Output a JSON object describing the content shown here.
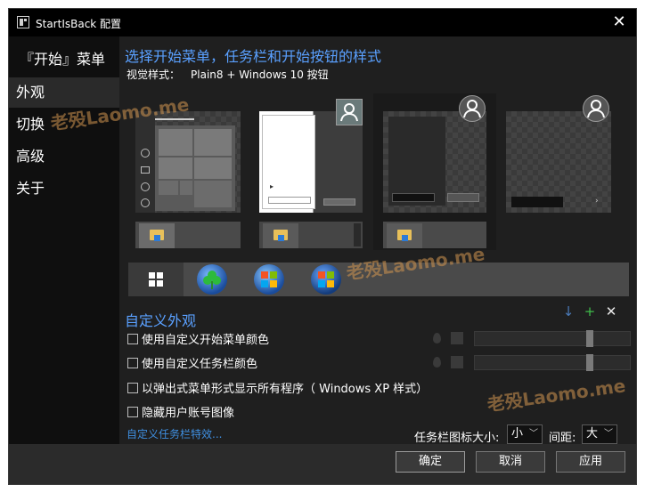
{
  "window": {
    "title": "StartIsBack 配置",
    "close_glyph": "✕"
  },
  "sidebar": {
    "header": "『开始』菜单",
    "items": [
      {
        "label": "外观",
        "active": true
      },
      {
        "label": "切换",
        "active": false
      },
      {
        "label": "高级",
        "active": false
      },
      {
        "label": "关于",
        "active": false
      }
    ]
  },
  "main": {
    "heading": "选择开始菜单，任务栏和开始按钮的样式",
    "visual_style_label": "视觉样式：",
    "visual_style_value": "Plain8 + Windows 10 按钮",
    "custom_heading": "自定义外观",
    "toolbar_icons": [
      "download-arrow-icon",
      "plus-icon",
      "close-icon"
    ],
    "options": [
      {
        "label": "使用自定义开始菜单颜色",
        "checked": false
      },
      {
        "label": "使用自定义任务栏颜色",
        "checked": false
      },
      {
        "label": "以弹出式菜单形式显示所有程序（ Windows XP 样式）",
        "checked": false
      },
      {
        "label": "隐藏用户账号图像",
        "checked": false
      }
    ],
    "color_levels": {
      "start_menu": 0.75,
      "taskbar": 0.75
    },
    "link_text": "自定义任务栏特效...",
    "icon_size_label": "任务栏图标大小:",
    "icon_size_value": "小",
    "spacing_label": "间距:",
    "spacing_value": "大"
  },
  "footer": {
    "ok": "确定",
    "cancel": "取消",
    "apply": "应用"
  },
  "watermark": "老殁Laomo.me",
  "colors": {
    "accent": "#5aa0ff",
    "link": "#3f8fe0",
    "window_bg": "#1f1f1f"
  }
}
